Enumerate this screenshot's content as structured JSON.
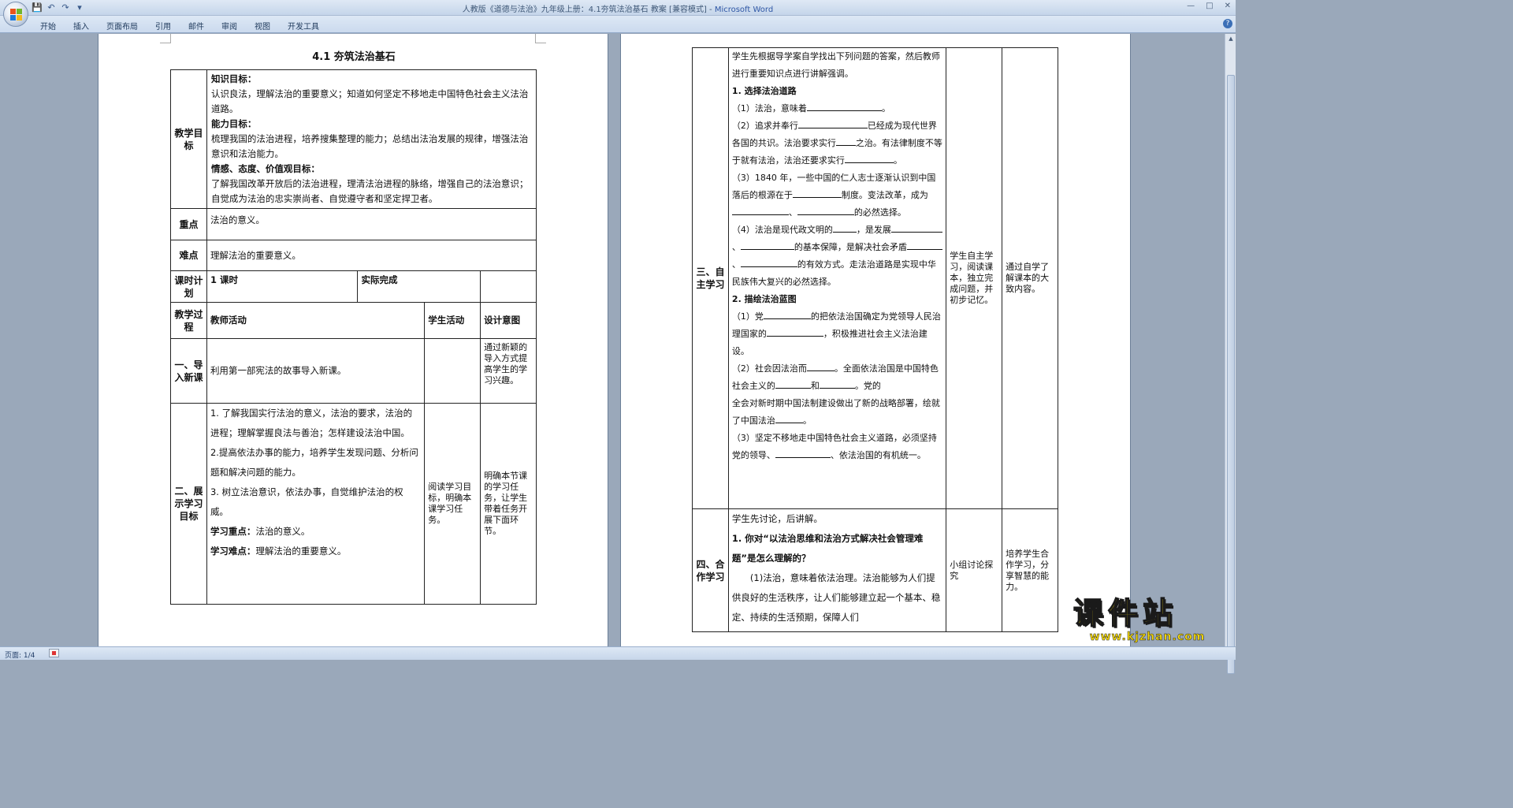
{
  "window": {
    "title": "人教版《道德与法治》九年级上册：4.1夯筑法治基石 教案 [兼容模式] - ",
    "app_name": "Microsoft Word"
  },
  "ribbon_tabs": [
    "开始",
    "插入",
    "页面布局",
    "引用",
    "邮件",
    "审阅",
    "视图",
    "开发工具"
  ],
  "status": {
    "page": "页面: 1/4"
  },
  "watermark": {
    "text": "课件站",
    "url": "www.kjzhan.com"
  },
  "page1": {
    "title": "4.1  夯筑法治基石",
    "goals_label": "教学目标",
    "goals": [
      {
        "heading": "知识目标：",
        "text": "认识良法，理解法治的重要意义；知道如何坚定不移地走中国特色社会主义法治道路。"
      },
      {
        "heading": "能力目标：",
        "text": "梳理我国的法治进程，培养搜集整理的能力；总结出法治发展的规律，增强法治意识和法治能力。"
      },
      {
        "heading": "情感、态度、价值观目标：",
        "text": "了解我国改革开放后的法治进程，理清法治进程的脉络，增强自己的法治意识；自觉成为法治的忠实崇尚者、自觉遵守者和坚定捍卫者。"
      }
    ],
    "key_label": "重点",
    "key_text": "法治的意义。",
    "difficult_label": "难点",
    "difficult_text": "理解法治的重要意义。",
    "plan_label": "课时计划",
    "plan_value": "1 课时",
    "actual_label": "实际完成",
    "process_label": "教学过程",
    "col_teacher": "教师活动",
    "col_student": "学生活动",
    "col_design": "设计意图",
    "step1_label": "一、导入新课",
    "step1_teacher": "利用第一部宪法的故事导入新课。",
    "step1_design": "通过新颖的导入方式提高学生的学习兴趣。",
    "step2_label": "二、展示学习目标",
    "step2_teacher": [
      "1. 了解我国实行法治的意义，法治的要求，法治的进程；理解掌握良法与善治；怎样建设法治中国。",
      "2.提高依法办事的能力，培养学生发现问题、分析问题和解决问题的能力。",
      "3. 树立法治意识，依法办事，自觉维护法治的权威。"
    ],
    "step2_focus_label": "学习重点：",
    "step2_focus": "法治的意义。",
    "step2_diff_label": "学习难点：",
    "step2_diff": "理解法治的重要意义。",
    "step2_student": "阅读学习目标，明确本课学习任务。",
    "step2_design": "明确本节课的学习任务，让学生带着任务开展下面环节。"
  },
  "page2": {
    "step3_label": "三、自主学习",
    "step3_intro": "学生先根据导学案自学找出下列问题的答案，然后教师进行重要知识点进行讲解强调。",
    "step3_h1": "1. 选择法治道路",
    "s3_l1": "（1）法治，意味着",
    "s3_l1b": "。",
    "s3_l2": "（2）追求并奉行",
    "s3_l2b": "已经成为现代世界各国的共识。法治要求实行",
    "s3_l2c": "之治。有法律制度不等于就有法治，法治还要求实行",
    "s3_l2d": "。",
    "s3_l3": "（3）1840 年，一些中国的仁人志士逐渐认识到中国落后的根源在于",
    "s3_l3b": "制度。变法改革，成为",
    "s3_l3c": "、",
    "s3_l3d": "的必然选择。",
    "s3_l4": "（4）法治是现代政文明的",
    "s3_l4b": "，是发展",
    "s3_l4c": "、",
    "s3_l4d": "的基本保障，是解决社会矛盾",
    "s3_l4e": "、",
    "s3_l4f": "的有效方式。走法治道路是实现中华民族伟大复兴的必然选择。",
    "step3_h2": "2. 描绘法治蓝图",
    "s3_m1": "（1）党",
    "s3_m1b": "的把依法治国确定为党领导人民治理国家的",
    "s3_m1c": "，积极推进社会主义法治建设。",
    "s3_m2": "（2）社会因法治而",
    "s3_m2b": "。全面依法治国是中国特色社会主义的",
    "s3_m2c": "和",
    "s3_m2d": "。党的",
    "s3_m2e": "全会对新时期中国法制建设做出了新的战略部署，绘就了中国法治",
    "s3_m2f": "。",
    "s3_m3": "（3）坚定不移地走中国特色社会主义道路，必须坚持党的领导、",
    "s3_m3b": "、依法治国的有机统一。",
    "step3_student": "学生自主学习，阅读课本，独立完成问题，并初步记忆。",
    "step3_design": "通过自学了解课本的大致内容。",
    "step4_label": "四、合作学习",
    "step4_intro": "学生先讨论，后讲解。",
    "step4_q": "1. 你对“以法治思维和法治方式解决社会管理难题”是怎么理解的？",
    "step4_a": "(1)法治，意味着依法治理。法治能够为人们提供良好的生活秩序，让人们能够建立起一个基本、稳定、持续的生活预期，保障人们",
    "step4_student": "小组讨论探究",
    "step4_design": "培养学生合作学习，分享智慧的能力。"
  }
}
